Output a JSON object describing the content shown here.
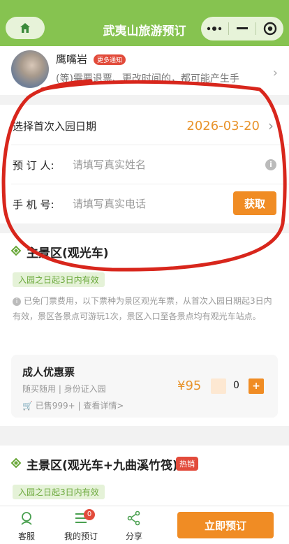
{
  "header": {
    "title": "武夷山旅游预订"
  },
  "notice": {
    "name": "鹰嘴岩",
    "badge": "更多通知",
    "text": "(等)需要退票、更改时间的，都可能产生手"
  },
  "form": {
    "date_label": "选择首次入园日期",
    "date_value": "2026-03-20",
    "booker_label": "预 订 人:",
    "booker_placeholder": "请填写真实姓名",
    "phone_label": "手 机 号:",
    "phone_placeholder": "请填写真实电话",
    "get_button": "获取"
  },
  "section1": {
    "title": "主景区(观光车)",
    "tag": "入园之日起3日内有效",
    "desc": "已免门票费用，以下票种为景区观光车票，从首次入园日期起3日内有效，景区各景点可游玩1次，景区入口至各景点均有观光车站点。",
    "ticket": {
      "name": "成人优惠票",
      "sub": "随买随用 | 身份证入园",
      "sold": "已售999+ | 查看详情>",
      "price": "¥95",
      "qty": "0",
      "plus": "+"
    }
  },
  "section2": {
    "title": "主景区(观光车+九曲溪竹筏)",
    "hot": "热销",
    "tag": "入园之日起3日内有效"
  },
  "bottom": {
    "tabs": [
      {
        "label": "客服",
        "icon": "service-icon"
      },
      {
        "label": "我的预订",
        "icon": "orders-icon",
        "badge": "0"
      },
      {
        "label": "分享",
        "icon": "share-icon"
      }
    ],
    "book_button": "立即预订"
  },
  "colors": {
    "header": "#86c350",
    "accent": "#f08c24",
    "date": "#e8932b",
    "annotation": "#d8261c"
  }
}
